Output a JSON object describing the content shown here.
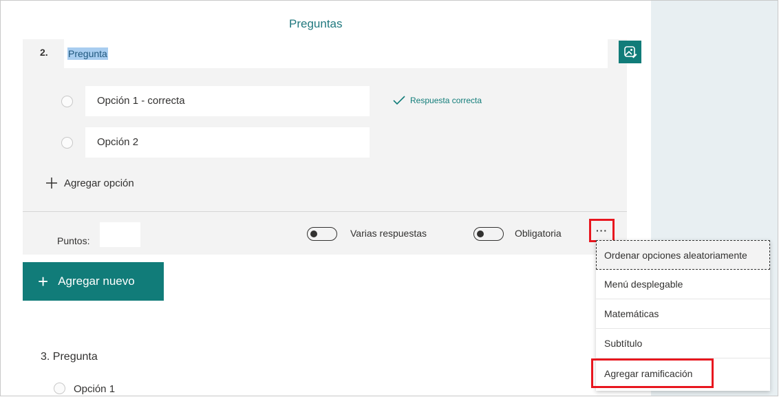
{
  "header": {
    "tab_title": "Preguntas"
  },
  "question2": {
    "number": "2.",
    "title": "Pregunta",
    "image_icon": "image-icon",
    "options": [
      {
        "label": "Opción 1 - correcta",
        "correct": true
      },
      {
        "label": "Opción 2",
        "correct": false
      }
    ],
    "correct_answer_label": "Respuesta correcta",
    "add_option_label": "Agregar opción",
    "points_label": "Puntos:",
    "points_value": "",
    "multiple_answers_label": "Varias respuestas",
    "required_label": "Obligatoria",
    "more_label": "···"
  },
  "add_new_label": "Agregar nuevo",
  "question3": {
    "title": "3. Pregunta",
    "option": "Opción 1"
  },
  "menu": {
    "items": [
      "Ordenar opciones aleatoriamente",
      "Menú desplegable",
      "Matemáticas",
      "Subtítulo",
      "Agregar ramificación"
    ]
  },
  "colors": {
    "accent": "#117c79",
    "highlight": "#e8161e",
    "panel": "#e8eff2"
  }
}
